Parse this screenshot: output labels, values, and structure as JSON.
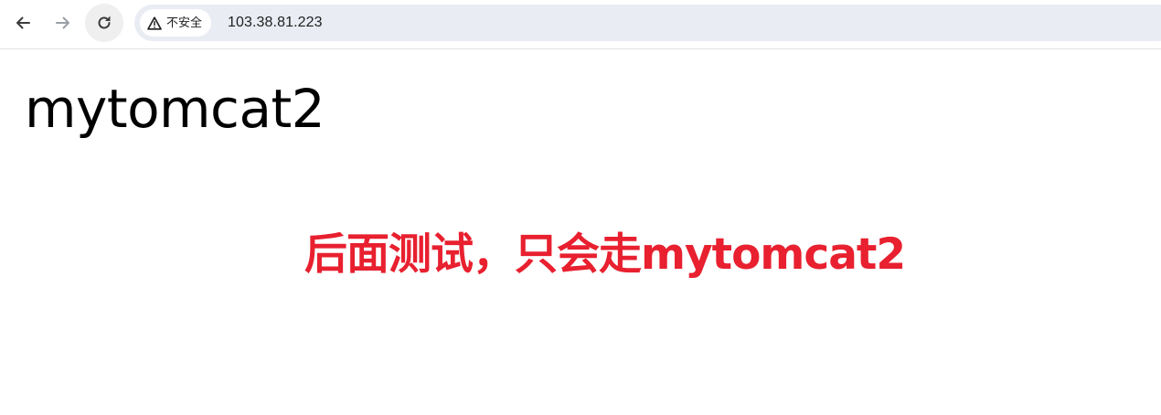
{
  "browser": {
    "icons": {
      "back": "arrow-left-icon",
      "forward": "arrow-right-icon",
      "reload": "reload-icon",
      "security": "warning-triangle-icon"
    },
    "security_label": "不安全",
    "url": "103.38.81.223",
    "colors": {
      "omnibox_bg": "#e9ecf3",
      "forward_disabled": "#9aa0a6"
    }
  },
  "page": {
    "heading": "mytomcat2",
    "annotation": "后面测试，只会走mytomcat2",
    "colors": {
      "annotation": "#e8202f"
    }
  }
}
